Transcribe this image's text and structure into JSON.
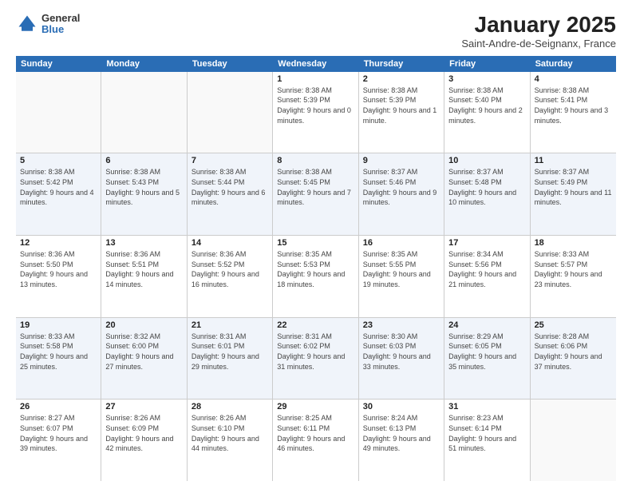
{
  "logo": {
    "general": "General",
    "blue": "Blue"
  },
  "title": "January 2025",
  "location": "Saint-Andre-de-Seignanx, France",
  "weekdays": [
    "Sunday",
    "Monday",
    "Tuesday",
    "Wednesday",
    "Thursday",
    "Friday",
    "Saturday"
  ],
  "weeks": [
    {
      "alt": false,
      "days": [
        {
          "num": "",
          "sunrise": "",
          "sunset": "",
          "daylight": ""
        },
        {
          "num": "",
          "sunrise": "",
          "sunset": "",
          "daylight": ""
        },
        {
          "num": "",
          "sunrise": "",
          "sunset": "",
          "daylight": ""
        },
        {
          "num": "1",
          "sunrise": "Sunrise: 8:38 AM",
          "sunset": "Sunset: 5:39 PM",
          "daylight": "Daylight: 9 hours and 0 minutes."
        },
        {
          "num": "2",
          "sunrise": "Sunrise: 8:38 AM",
          "sunset": "Sunset: 5:39 PM",
          "daylight": "Daylight: 9 hours and 1 minute."
        },
        {
          "num": "3",
          "sunrise": "Sunrise: 8:38 AM",
          "sunset": "Sunset: 5:40 PM",
          "daylight": "Daylight: 9 hours and 2 minutes."
        },
        {
          "num": "4",
          "sunrise": "Sunrise: 8:38 AM",
          "sunset": "Sunset: 5:41 PM",
          "daylight": "Daylight: 9 hours and 3 minutes."
        }
      ]
    },
    {
      "alt": true,
      "days": [
        {
          "num": "5",
          "sunrise": "Sunrise: 8:38 AM",
          "sunset": "Sunset: 5:42 PM",
          "daylight": "Daylight: 9 hours and 4 minutes."
        },
        {
          "num": "6",
          "sunrise": "Sunrise: 8:38 AM",
          "sunset": "Sunset: 5:43 PM",
          "daylight": "Daylight: 9 hours and 5 minutes."
        },
        {
          "num": "7",
          "sunrise": "Sunrise: 8:38 AM",
          "sunset": "Sunset: 5:44 PM",
          "daylight": "Daylight: 9 hours and 6 minutes."
        },
        {
          "num": "8",
          "sunrise": "Sunrise: 8:38 AM",
          "sunset": "Sunset: 5:45 PM",
          "daylight": "Daylight: 9 hours and 7 minutes."
        },
        {
          "num": "9",
          "sunrise": "Sunrise: 8:37 AM",
          "sunset": "Sunset: 5:46 PM",
          "daylight": "Daylight: 9 hours and 9 minutes."
        },
        {
          "num": "10",
          "sunrise": "Sunrise: 8:37 AM",
          "sunset": "Sunset: 5:48 PM",
          "daylight": "Daylight: 9 hours and 10 minutes."
        },
        {
          "num": "11",
          "sunrise": "Sunrise: 8:37 AM",
          "sunset": "Sunset: 5:49 PM",
          "daylight": "Daylight: 9 hours and 11 minutes."
        }
      ]
    },
    {
      "alt": false,
      "days": [
        {
          "num": "12",
          "sunrise": "Sunrise: 8:36 AM",
          "sunset": "Sunset: 5:50 PM",
          "daylight": "Daylight: 9 hours and 13 minutes."
        },
        {
          "num": "13",
          "sunrise": "Sunrise: 8:36 AM",
          "sunset": "Sunset: 5:51 PM",
          "daylight": "Daylight: 9 hours and 14 minutes."
        },
        {
          "num": "14",
          "sunrise": "Sunrise: 8:36 AM",
          "sunset": "Sunset: 5:52 PM",
          "daylight": "Daylight: 9 hours and 16 minutes."
        },
        {
          "num": "15",
          "sunrise": "Sunrise: 8:35 AM",
          "sunset": "Sunset: 5:53 PM",
          "daylight": "Daylight: 9 hours and 18 minutes."
        },
        {
          "num": "16",
          "sunrise": "Sunrise: 8:35 AM",
          "sunset": "Sunset: 5:55 PM",
          "daylight": "Daylight: 9 hours and 19 minutes."
        },
        {
          "num": "17",
          "sunrise": "Sunrise: 8:34 AM",
          "sunset": "Sunset: 5:56 PM",
          "daylight": "Daylight: 9 hours and 21 minutes."
        },
        {
          "num": "18",
          "sunrise": "Sunrise: 8:33 AM",
          "sunset": "Sunset: 5:57 PM",
          "daylight": "Daylight: 9 hours and 23 minutes."
        }
      ]
    },
    {
      "alt": true,
      "days": [
        {
          "num": "19",
          "sunrise": "Sunrise: 8:33 AM",
          "sunset": "Sunset: 5:58 PM",
          "daylight": "Daylight: 9 hours and 25 minutes."
        },
        {
          "num": "20",
          "sunrise": "Sunrise: 8:32 AM",
          "sunset": "Sunset: 6:00 PM",
          "daylight": "Daylight: 9 hours and 27 minutes."
        },
        {
          "num": "21",
          "sunrise": "Sunrise: 8:31 AM",
          "sunset": "Sunset: 6:01 PM",
          "daylight": "Daylight: 9 hours and 29 minutes."
        },
        {
          "num": "22",
          "sunrise": "Sunrise: 8:31 AM",
          "sunset": "Sunset: 6:02 PM",
          "daylight": "Daylight: 9 hours and 31 minutes."
        },
        {
          "num": "23",
          "sunrise": "Sunrise: 8:30 AM",
          "sunset": "Sunset: 6:03 PM",
          "daylight": "Daylight: 9 hours and 33 minutes."
        },
        {
          "num": "24",
          "sunrise": "Sunrise: 8:29 AM",
          "sunset": "Sunset: 6:05 PM",
          "daylight": "Daylight: 9 hours and 35 minutes."
        },
        {
          "num": "25",
          "sunrise": "Sunrise: 8:28 AM",
          "sunset": "Sunset: 6:06 PM",
          "daylight": "Daylight: 9 hours and 37 minutes."
        }
      ]
    },
    {
      "alt": false,
      "days": [
        {
          "num": "26",
          "sunrise": "Sunrise: 8:27 AM",
          "sunset": "Sunset: 6:07 PM",
          "daylight": "Daylight: 9 hours and 39 minutes."
        },
        {
          "num": "27",
          "sunrise": "Sunrise: 8:26 AM",
          "sunset": "Sunset: 6:09 PM",
          "daylight": "Daylight: 9 hours and 42 minutes."
        },
        {
          "num": "28",
          "sunrise": "Sunrise: 8:26 AM",
          "sunset": "Sunset: 6:10 PM",
          "daylight": "Daylight: 9 hours and 44 minutes."
        },
        {
          "num": "29",
          "sunrise": "Sunrise: 8:25 AM",
          "sunset": "Sunset: 6:11 PM",
          "daylight": "Daylight: 9 hours and 46 minutes."
        },
        {
          "num": "30",
          "sunrise": "Sunrise: 8:24 AM",
          "sunset": "Sunset: 6:13 PM",
          "daylight": "Daylight: 9 hours and 49 minutes."
        },
        {
          "num": "31",
          "sunrise": "Sunrise: 8:23 AM",
          "sunset": "Sunset: 6:14 PM",
          "daylight": "Daylight: 9 hours and 51 minutes."
        },
        {
          "num": "",
          "sunrise": "",
          "sunset": "",
          "daylight": ""
        }
      ]
    }
  ]
}
